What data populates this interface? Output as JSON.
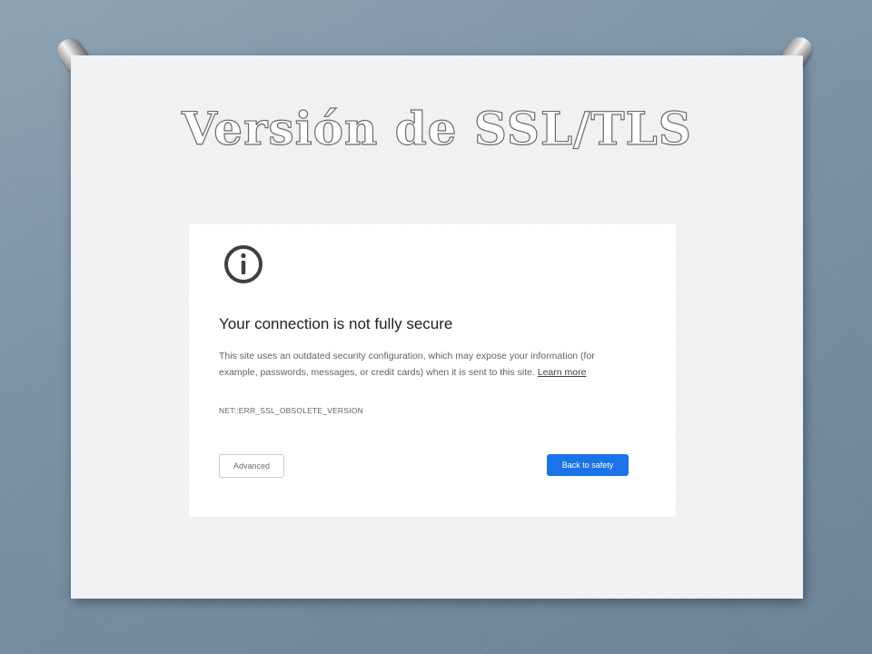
{
  "slide": {
    "title": "Versión de SSL/TLS"
  },
  "dialog": {
    "icon": "info-icon",
    "heading": "Your connection is not fully secure",
    "body_text": "This site uses an outdated security configuration, which may expose your information (for example, passwords, messages, or credit cards) when it is sent to this site.",
    "learn_more_label": "Learn more",
    "error_code": "NET::ERR_SSL_OBSOLETE_VERSION",
    "advanced_label": "Advanced",
    "back_to_safety_label": "Back to safety"
  },
  "colors": {
    "primary_button": "#1a73e8",
    "background": "#7b93a7",
    "paper": "#f1f2f4"
  }
}
